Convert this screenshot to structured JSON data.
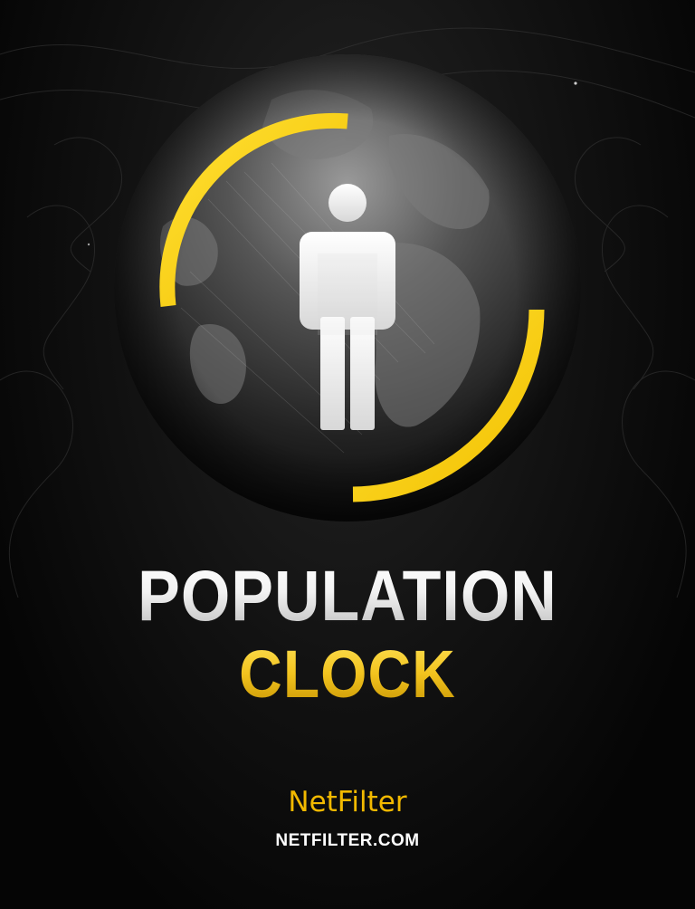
{
  "title": {
    "line1": "POPULATION",
    "line2": "CLOCK"
  },
  "brand": {
    "name": "NetFilter",
    "url": "NETFILTER.COM"
  },
  "icons": {
    "figure": "person-icon",
    "ring": "progress-arc",
    "background": "earth-globe"
  },
  "colors": {
    "accent": "#f5d20f",
    "brand_text": "#f2b900",
    "background": "#050505"
  }
}
